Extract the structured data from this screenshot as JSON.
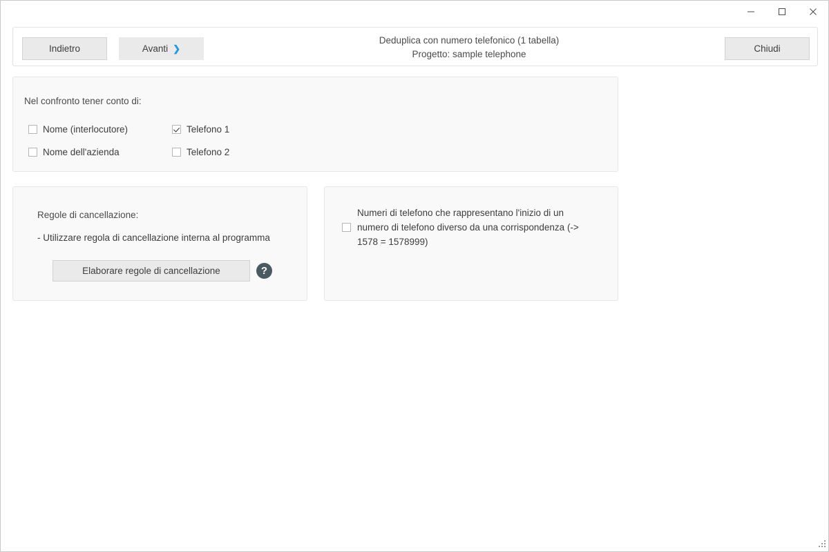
{
  "window": {
    "controls": {
      "minimize_label": "minimize",
      "maximize_label": "maximize",
      "close_label": "close"
    }
  },
  "toolbar": {
    "back_label": "Indietro",
    "next_label": "Avanti",
    "next_chevron": "❯",
    "close_label": "Chiudi",
    "title_line1": "Deduplica con numero telefonico (1 tabella)",
    "title_line2": "Progetto: sample telephone"
  },
  "compare_panel": {
    "heading": "Nel confronto tener conto di:",
    "checkboxes": [
      {
        "label": "Nome (interlocutore)",
        "checked": false
      },
      {
        "label": "Nome dell'azienda",
        "checked": false
      },
      {
        "label": "Telefono 1",
        "checked": true
      },
      {
        "label": "Telefono 2",
        "checked": false
      }
    ]
  },
  "rules_panel": {
    "heading": "Regole di cancellazione:",
    "detail": "- Utilizzare regola di cancellazione interna al programma",
    "button_label": "Elaborare regole di cancellazione",
    "help_glyph": "?"
  },
  "start_number_panel": {
    "checkbox": {
      "label": "Numeri di telefono che rappresentano l'inizio di un numero di telefono diverso da una corrispondenza (-> 1578 = 1578999)",
      "checked": false
    }
  },
  "colors": {
    "accent_blue": "#1e9ae0",
    "panel_background": "#f9f9f9",
    "panel_border": "#e6e6e6",
    "button_face": "#eaeaea",
    "help_badge": "#4a5a63",
    "text": "#3c3c3c"
  }
}
